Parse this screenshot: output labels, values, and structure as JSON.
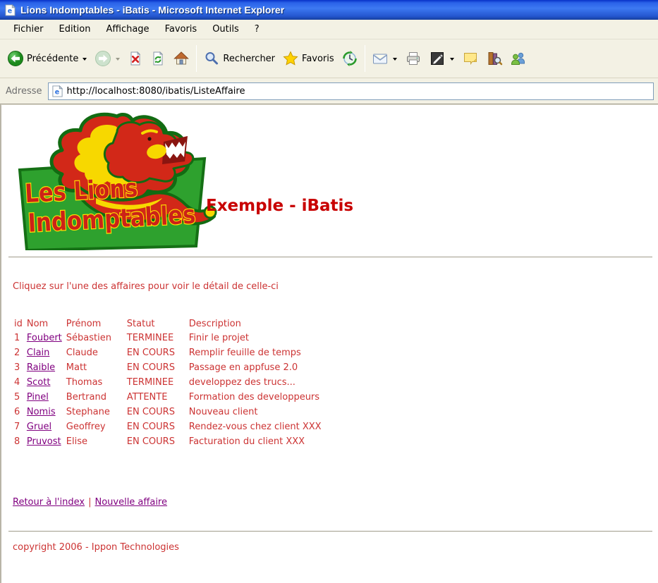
{
  "titlebar": {
    "title": "Lions Indomptables - iBatis - Microsoft Internet Explorer"
  },
  "menu": {
    "items": [
      "Fichier",
      "Edition",
      "Affichage",
      "Favoris",
      "Outils",
      "?"
    ]
  },
  "toolbar": {
    "back_label": "Précédente",
    "search_label": "Rechercher",
    "favorites_label": "Favoris"
  },
  "address": {
    "label": "Adresse",
    "url": "http://localhost:8080/ibatis/ListeAffaire"
  },
  "logo": {
    "line1": "Les Lions",
    "line2": "Indomptables"
  },
  "page": {
    "heading": "Exemple - iBatis",
    "intro": "Cliquez sur l'une des affaires pour voir le détail de celle-ci",
    "table": {
      "headers": [
        "id",
        "Nom",
        "Prénom",
        "Statut",
        "Description"
      ],
      "rows": [
        {
          "id": "1",
          "nom": "Foubert",
          "prenom": "Sébastien",
          "statut": "TERMINEE",
          "description": "Finir le projet"
        },
        {
          "id": "2",
          "nom": "Clain",
          "prenom": "Claude",
          "statut": "EN COURS",
          "description": "Remplir feuille de temps"
        },
        {
          "id": "3",
          "nom": "Raible",
          "prenom": "Matt",
          "statut": "EN COURS",
          "description": "Passage en appfuse 2.0"
        },
        {
          "id": "4",
          "nom": "Scott",
          "prenom": "Thomas",
          "statut": "TERMINEE",
          "description": "developpez des trucs..."
        },
        {
          "id": "5",
          "nom": "Pinel",
          "prenom": "Bertrand",
          "statut": "ATTENTE",
          "description": "Formation des developpeurs"
        },
        {
          "id": "6",
          "nom": "Nomis",
          "prenom": "Stephane",
          "statut": "EN COURS",
          "description": "Nouveau client"
        },
        {
          "id": "7",
          "nom": "Gruel",
          "prenom": "Geoffrey",
          "statut": "EN COURS",
          "description": "Rendez-vous chez client XXX"
        },
        {
          "id": "8",
          "nom": "Pruvost",
          "prenom": "Elise",
          "statut": "EN COURS",
          "description": "Facturation du client XXX"
        }
      ]
    },
    "links": {
      "back_index": "Retour à l'index",
      "separator": "|",
      "new_affair": "Nouvelle affaire"
    },
    "footer": "copyright 2006 - Ippon Technologies"
  },
  "icons": {
    "ie_glyph": "e",
    "names": [
      "ie-page-icon",
      "back-icon",
      "forward-icon",
      "stop-icon",
      "refresh-icon",
      "home-icon",
      "search-icon",
      "favorites-icon",
      "history-icon",
      "mail-icon",
      "print-icon",
      "edit-icon",
      "discuss-icon",
      "research-icon",
      "messenger-icon",
      "chevron-down-icon"
    ]
  },
  "colors": {
    "titlebar_blue": "#2a5fe0",
    "chrome_tan": "#f3f1e4",
    "page_red": "#cc3333",
    "heading_red": "#c80000",
    "link_purple": "#800080",
    "logo_green": "#2ea12e",
    "logo_yellow": "#f7d800",
    "logo_red": "#d22818"
  }
}
